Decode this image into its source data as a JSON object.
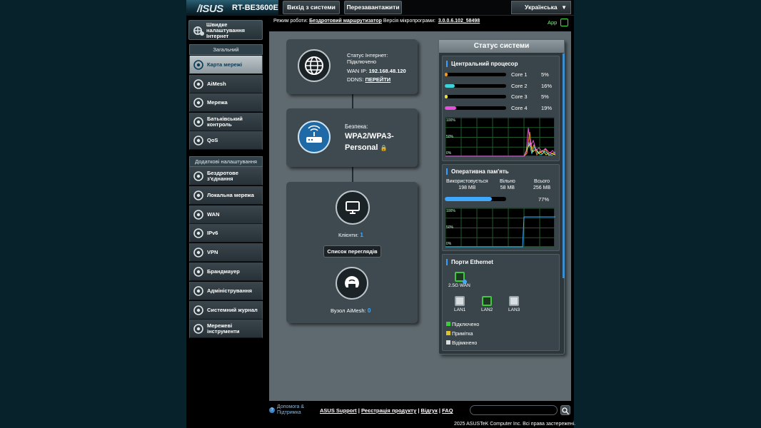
{
  "header": {
    "logo": "/ISUS",
    "model": "RT-BE3600E",
    "logout_label": "Вихід з системи",
    "reboot_label": "Перезавантажити",
    "language": "Українська"
  },
  "sidebar": {
    "quick_label": "Швидке налаштування Інтернет",
    "general_header": "Загальний",
    "general_items": [
      "Карта мережі",
      "AiMesh",
      "Мережа",
      "Батьківський контроль",
      "QoS"
    ],
    "advanced_header": "Додаткові налаштування",
    "advanced_items": [
      "Бездротове з'єднання",
      "Локальна мережа",
      "WAN",
      "IPv6",
      "VPN",
      "Брандмауер",
      "Адміністрування",
      "Системний журнал",
      "Мережеві інструменти"
    ]
  },
  "infobar": {
    "mode_label": "Режим роботи:",
    "mode_value": "Бездротовий маршрутизатор",
    "fw_label": "Версія мікропрограми:",
    "fw_value": "3.0.0.6.102_58498",
    "app_label": "App"
  },
  "internet": {
    "status_label": "Статус Інтернет:",
    "status_value": "Підключено",
    "wan_ip_label": "WAN IP:",
    "wan_ip": "192.168.48.120",
    "ddns_label": "DDNS:",
    "ddns_link": "ПЕРЕЙТИ"
  },
  "security": {
    "label": "Безпека:",
    "value": "WPA2/WPA3-Personal"
  },
  "clients": {
    "label": "Клієнти:",
    "count": "1",
    "button": "Список переглядів",
    "aimesh_label": "Вузол AiMesh:",
    "aimesh_count": "0"
  },
  "status": {
    "title": "Статус системи",
    "cpu_title": "Центральний процесор",
    "cores": [
      {
        "name": "Core 1",
        "pct": "5%",
        "value": 0.05,
        "color": "#f39a1e"
      },
      {
        "name": "Core 2",
        "pct": "16%",
        "value": 0.16,
        "color": "#3fd1d8"
      },
      {
        "name": "Core 3",
        "pct": "5%",
        "value": 0.05,
        "color": "#f2e337"
      },
      {
        "name": "Core 4",
        "pct": "19%",
        "value": 0.19,
        "color": "#e64fd8"
      }
    ],
    "graph_labels": [
      "100%",
      "50%",
      "0%"
    ],
    "ram_title": "Оперативна пам'ять",
    "ram_used_label": "Використовується",
    "ram_used": "198 MB",
    "ram_free_label": "Вільно",
    "ram_free": "58 MB",
    "ram_total_label": "Всього",
    "ram_total": "256 MB",
    "ram_pct": "77%",
    "ram_value": 0.77,
    "eth_title": "Порти Ethernet",
    "wan_port": "2.5G WAN",
    "lan_ports": [
      "LAN1",
      "LAN2",
      "LAN3"
    ],
    "legend": [
      "Підключено",
      "Примітка",
      "Відімкнено"
    ],
    "colors": {
      "connected": "#3fc93f",
      "note": "#e2c22b",
      "off": "#d8dde0"
    }
  },
  "footer": {
    "help": "Допомога & Підтримка",
    "asus_support": "ASUS Support",
    "register": "Реєстрація продукту",
    "faq_vidguk": "Відгук",
    "faq": "FAQ",
    "copyright": "2025 ASUSTeK Computer Inc. Всі права застережені."
  }
}
